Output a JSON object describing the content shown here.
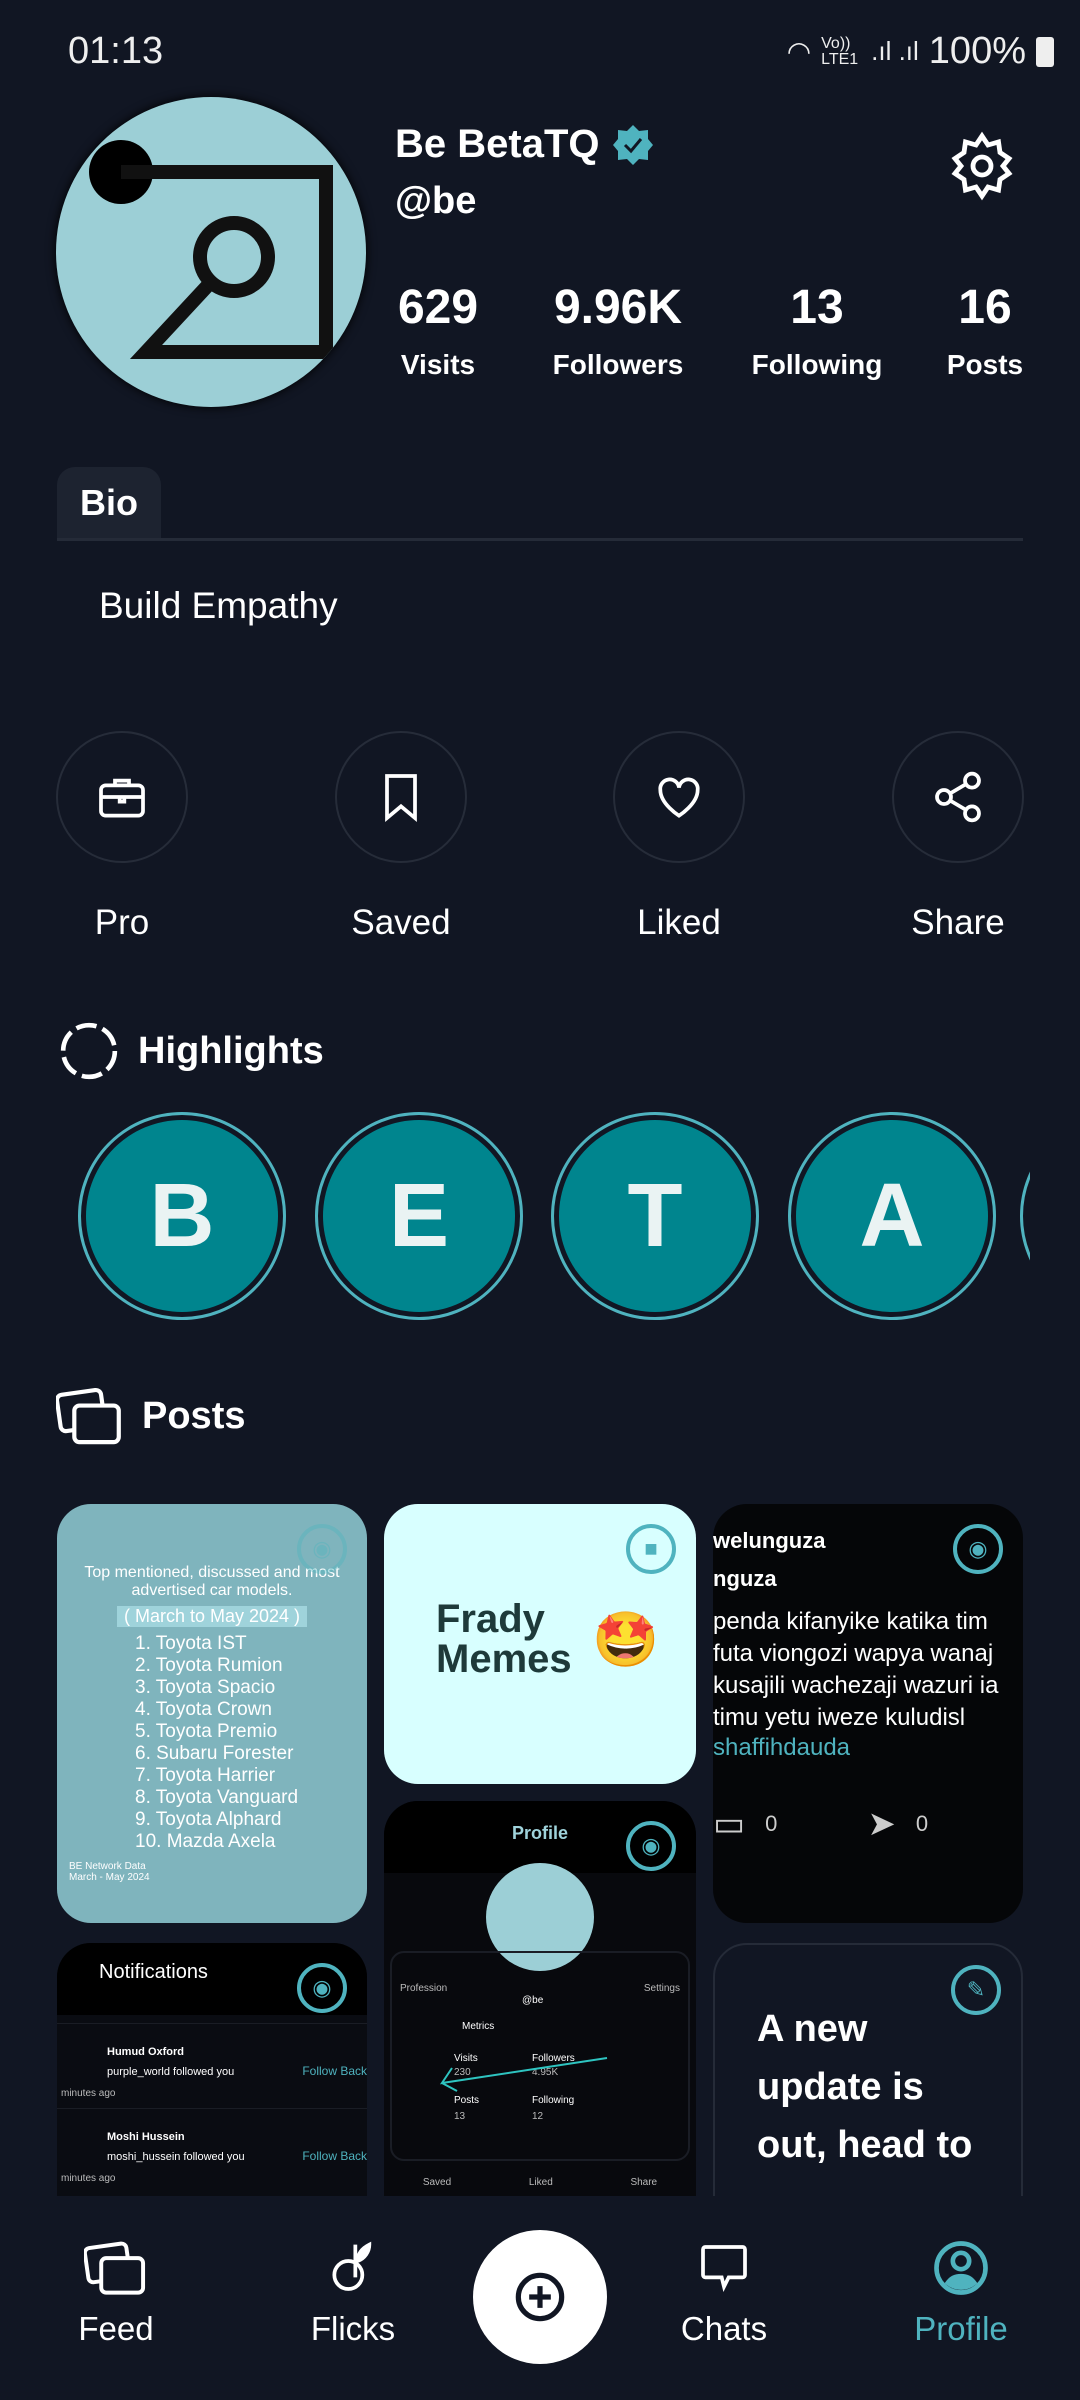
{
  "status_bar": {
    "time": "01:13",
    "network": "Vo)) LTE1",
    "battery": "100%"
  },
  "profile": {
    "name": "Be BetaTQ",
    "handle": "@be",
    "verified": true,
    "stats": [
      {
        "value": "629",
        "label": "Visits"
      },
      {
        "value": "9.96K",
        "label": "Followers"
      },
      {
        "value": "13",
        "label": "Following"
      },
      {
        "value": "16",
        "label": "Posts"
      }
    ]
  },
  "bio": {
    "tab": "Bio",
    "text": "Build Empathy"
  },
  "actions": [
    {
      "label": "Pro",
      "icon": "briefcase-icon"
    },
    {
      "label": "Saved",
      "icon": "bookmark-icon"
    },
    {
      "label": "Liked",
      "icon": "heart-icon"
    },
    {
      "label": "Share",
      "icon": "share-icon"
    }
  ],
  "highlights": {
    "title": "Highlights",
    "items": [
      "B",
      "E",
      "T",
      "A"
    ]
  },
  "posts": {
    "title": "Posts",
    "p1": {
      "heading": "Top mentioned, discussed and most advertised car models.",
      "period": "( March to May 2024 )",
      "list": [
        "1. Toyota IST",
        "2. Toyota Rumion",
        "3. Toyota Spacio",
        "4. Toyota Crown",
        "5. Toyota Premio",
        "6. Subaru Forester",
        "7. Toyota Harrier",
        "8. Toyota Vanguard",
        "9. Toyota Alphard",
        "10. Mazda Axela"
      ],
      "source": "BE Network Data March - May 2024"
    },
    "p2": {
      "text1": "Frady",
      "text2": "Memes"
    },
    "p3": {
      "line1": "welunguza",
      "line2": "nguza",
      "body": "penda kifanyike katika tim futa viongozi wapya wanaj kusajili wachezaji wazuri ia timu yetu iweze kuludisl",
      "mention": "shaffihdauda",
      "comments": "0",
      "shares": "0"
    },
    "p4": {
      "title": "Notifications",
      "n1_name": "Humud Oxford",
      "n1_text": "purple_world followed you",
      "n2_name": "Moshi Hussein",
      "n2_text": "moshi_hussein followed you",
      "follow": "Follow Back",
      "ago": "minutes ago"
    },
    "p5": {
      "title": "Profile",
      "handle": "@be",
      "profession": "Profession",
      "settings": "Settings",
      "metrics": "Metrics",
      "visits": "Visits",
      "visits_v": "230",
      "followers": "Followers",
      "followers_v": "4.95K",
      "posts": "Posts",
      "posts_v": "13",
      "following": "Following",
      "following_v": "12",
      "saved": "Saved",
      "liked": "Liked",
      "share": "Share"
    },
    "p6": {
      "text": "A new update is out, head to"
    }
  },
  "nav": [
    {
      "label": "Feed"
    },
    {
      "label": "Flicks"
    },
    {
      "label": "Chats"
    },
    {
      "label": "Profile",
      "active": true
    }
  ],
  "colors": {
    "accent": "#4fb3bf",
    "background": "#111623",
    "highlight": "#00858e"
  }
}
